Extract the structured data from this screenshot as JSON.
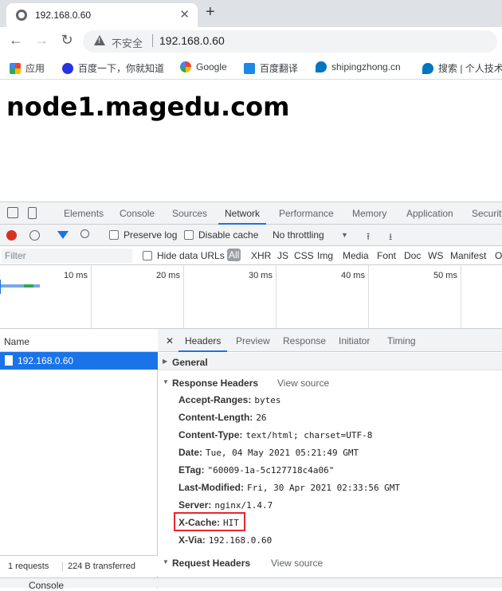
{
  "tab": {
    "title": "192.168.0.60",
    "close": "✕"
  },
  "newtab": "+",
  "nav": {
    "back": "←",
    "forward": "→",
    "reload": "↻"
  },
  "omnibox": {
    "insecure_label": "不安全",
    "url": "192.168.0.60"
  },
  "bookmarks": [
    {
      "label": "应用",
      "icon": "apps-grid-icon",
      "color": "#ea4335"
    },
    {
      "label": "百度一下，你就知道",
      "icon": "baidu-paw-icon",
      "color": "#2932e1"
    },
    {
      "label": "Google",
      "icon": "google-icon",
      "color": "#4285f4"
    },
    {
      "label": "百度翻译",
      "icon": "translate-icon",
      "color": "#1e88e5"
    },
    {
      "label": "shipingzhong.cn",
      "icon": "drupal-icon",
      "color": "#0077c0"
    },
    {
      "label": "搜索 | 个人技术",
      "icon": "drupal-icon",
      "color": "#0077c0"
    }
  ],
  "page": {
    "heading": "node1.magedu.com"
  },
  "devtools": {
    "tabs": [
      "Elements",
      "Console",
      "Sources",
      "Network",
      "Performance",
      "Memory",
      "Application",
      "Security"
    ],
    "active_tab": "Network",
    "toolbar": {
      "preserve_log": "Preserve log",
      "disable_cache": "Disable cache",
      "throttling": "No throttling"
    },
    "filter": {
      "placeholder": "Filter",
      "hide_data_urls": "Hide data URLs",
      "types": [
        "All",
        "XHR",
        "JS",
        "CSS",
        "Img",
        "Media",
        "Font",
        "Doc",
        "WS",
        "Manifest",
        "Other"
      ]
    },
    "overview": {
      "ticks": [
        "10 ms",
        "20 ms",
        "30 ms",
        "40 ms",
        "50 ms"
      ]
    },
    "requests": {
      "column_name": "Name",
      "rows": [
        {
          "name": "192.168.0.60"
        }
      ],
      "status": {
        "requests": "1 requests",
        "transferred": "224 B transferred"
      }
    },
    "detail": {
      "close": "✕",
      "tabs": [
        "Headers",
        "Preview",
        "Response",
        "Initiator",
        "Timing"
      ],
      "active_tab": "Headers",
      "general": "General",
      "response_headers_title": "Response Headers",
      "view_source": "View source",
      "request_headers_title": "Request Headers",
      "response_headers": [
        {
          "name": "Accept-Ranges:",
          "value": "bytes"
        },
        {
          "name": "Content-Length:",
          "value": "26"
        },
        {
          "name": "Content-Type:",
          "value": "text/html; charset=UTF-8"
        },
        {
          "name": "Date:",
          "value": "Tue, 04 May 2021 05:21:49 GMT"
        },
        {
          "name": "ETag:",
          "value": "\"60009-1a-5c127718c4a06\""
        },
        {
          "name": "Last-Modified:",
          "value": "Fri, 30 Apr 2021 02:33:56 GMT"
        },
        {
          "name": "Server:",
          "value": "nginx/1.4.7"
        },
        {
          "name": "X-Cache:",
          "value": "HIT"
        },
        {
          "name": "X-Via:",
          "value": "192.168.0.60"
        }
      ],
      "highlight_color": "#e8262d"
    },
    "drawer": {
      "label": "Console"
    }
  }
}
